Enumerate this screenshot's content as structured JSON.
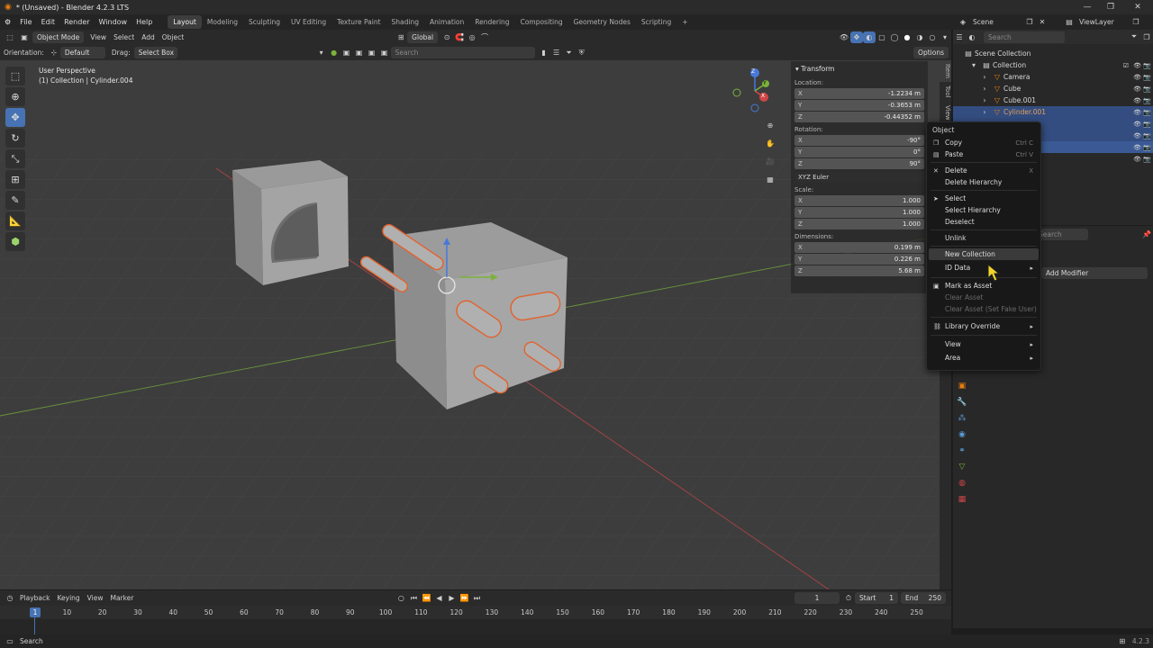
{
  "window": {
    "title": "* (Unsaved) - Blender 4.2.3 LTS",
    "minimize": "—",
    "maximize": "❐",
    "close": "✕"
  },
  "menu": {
    "items": [
      "File",
      "Edit",
      "Render",
      "Window",
      "Help"
    ]
  },
  "workspaces": [
    "Layout",
    "Modeling",
    "Sculpting",
    "UV Editing",
    "Texture Paint",
    "Shading",
    "Animation",
    "Rendering",
    "Compositing",
    "Geometry Nodes",
    "Scripting"
  ],
  "workspace_add": "+",
  "scene": {
    "name": "Scene",
    "view_layer": "ViewLayer"
  },
  "viewport_header": {
    "mode": "Object Mode",
    "menus": [
      "View",
      "Select",
      "Add",
      "Object"
    ],
    "transform_orientation": "Global",
    "options": "Options"
  },
  "tool_settings": {
    "orientation_label": "Orientation:",
    "orientation_value": "Default",
    "drag_label": "Drag:",
    "drag_value": "Select Box"
  },
  "viewport_search_placeholder": "Search",
  "viewport_info": {
    "perspective": "User Perspective",
    "collection": "(1) Collection | Cylinder.004"
  },
  "gizmo": {
    "x": "X",
    "y": "Y",
    "z": "Z"
  },
  "npanel": {
    "title": "Transform",
    "location_label": "Location:",
    "location": [
      {
        "axis": "X",
        "value": "-1.2234 m"
      },
      {
        "axis": "Y",
        "value": "-0.3653 m"
      },
      {
        "axis": "Z",
        "value": "-0.44352 m"
      }
    ],
    "rotation_label": "Rotation:",
    "rotation": [
      {
        "axis": "X",
        "value": "-90°"
      },
      {
        "axis": "Y",
        "value": "0°"
      },
      {
        "axis": "Z",
        "value": "90°"
      }
    ],
    "rotation_mode": "XYZ Euler",
    "scale_label": "Scale:",
    "scale": [
      {
        "axis": "X",
        "value": "1.000"
      },
      {
        "axis": "Y",
        "value": "1.000"
      },
      {
        "axis": "Z",
        "value": "1.000"
      }
    ],
    "dimensions_label": "Dimensions:",
    "dimensions": [
      {
        "axis": "X",
        "value": "0.199 m"
      },
      {
        "axis": "Y",
        "value": "0.226 m"
      },
      {
        "axis": "Z",
        "value": "5.68 m"
      }
    ]
  },
  "npanel_tabs": [
    "Item",
    "Tool",
    "View"
  ],
  "outliner": {
    "search_placeholder": "Search",
    "rows": [
      "Scene Collection",
      "Collection",
      "Camera",
      "Cube",
      "Cube.001",
      "Cylinder.001"
    ]
  },
  "properties": {
    "search_placeholder": "Search",
    "add_modifier": "Add Modifier"
  },
  "context_menu": {
    "title": "Object",
    "items": [
      {
        "label": "Copy",
        "shortcut": "Ctrl C"
      },
      {
        "label": "Paste",
        "shortcut": "Ctrl V"
      },
      {
        "label": "Delete",
        "shortcut": "X"
      },
      {
        "label": "Delete Hierarchy",
        "shortcut": ""
      },
      {
        "label": "Select",
        "shortcut": ""
      },
      {
        "label": "Select Hierarchy",
        "shortcut": ""
      },
      {
        "label": "Deselect",
        "shortcut": ""
      },
      {
        "label": "Unlink",
        "shortcut": ""
      },
      {
        "label": "New Collection",
        "shortcut": ""
      },
      {
        "label": "ID Data",
        "shortcut": "▸"
      },
      {
        "label": "Mark as Asset",
        "shortcut": ""
      },
      {
        "label": "Clear Asset",
        "shortcut": ""
      },
      {
        "label": "Clear Asset (Set Fake User)",
        "shortcut": ""
      },
      {
        "label": "Library Override",
        "shortcut": "▸"
      },
      {
        "label": "View",
        "shortcut": "▸"
      },
      {
        "label": "Area",
        "shortcut": "▸"
      }
    ]
  },
  "timeline_header": {
    "menus": [
      "Playback",
      "Keying",
      "View",
      "Marker"
    ],
    "current_frame": "1",
    "start_label": "Start",
    "start_value": "1",
    "end_label": "End",
    "end_value": "250"
  },
  "timeline": {
    "current": "1",
    "ticks": [
      "10",
      "20",
      "30",
      "40",
      "50",
      "60",
      "70",
      "80",
      "90",
      "100",
      "110",
      "120",
      "130",
      "140",
      "150",
      "160",
      "170",
      "180",
      "190",
      "200",
      "210",
      "220",
      "230",
      "240",
      "250"
    ]
  },
  "status": {
    "left": "Search",
    "version": "4.2.3"
  },
  "colors": {
    "accent": "#4772b3",
    "selection_outline": "#e2622c",
    "x_axis": "#d04646",
    "y_axis": "#7ab33a",
    "highlight_row": "#334d80"
  }
}
